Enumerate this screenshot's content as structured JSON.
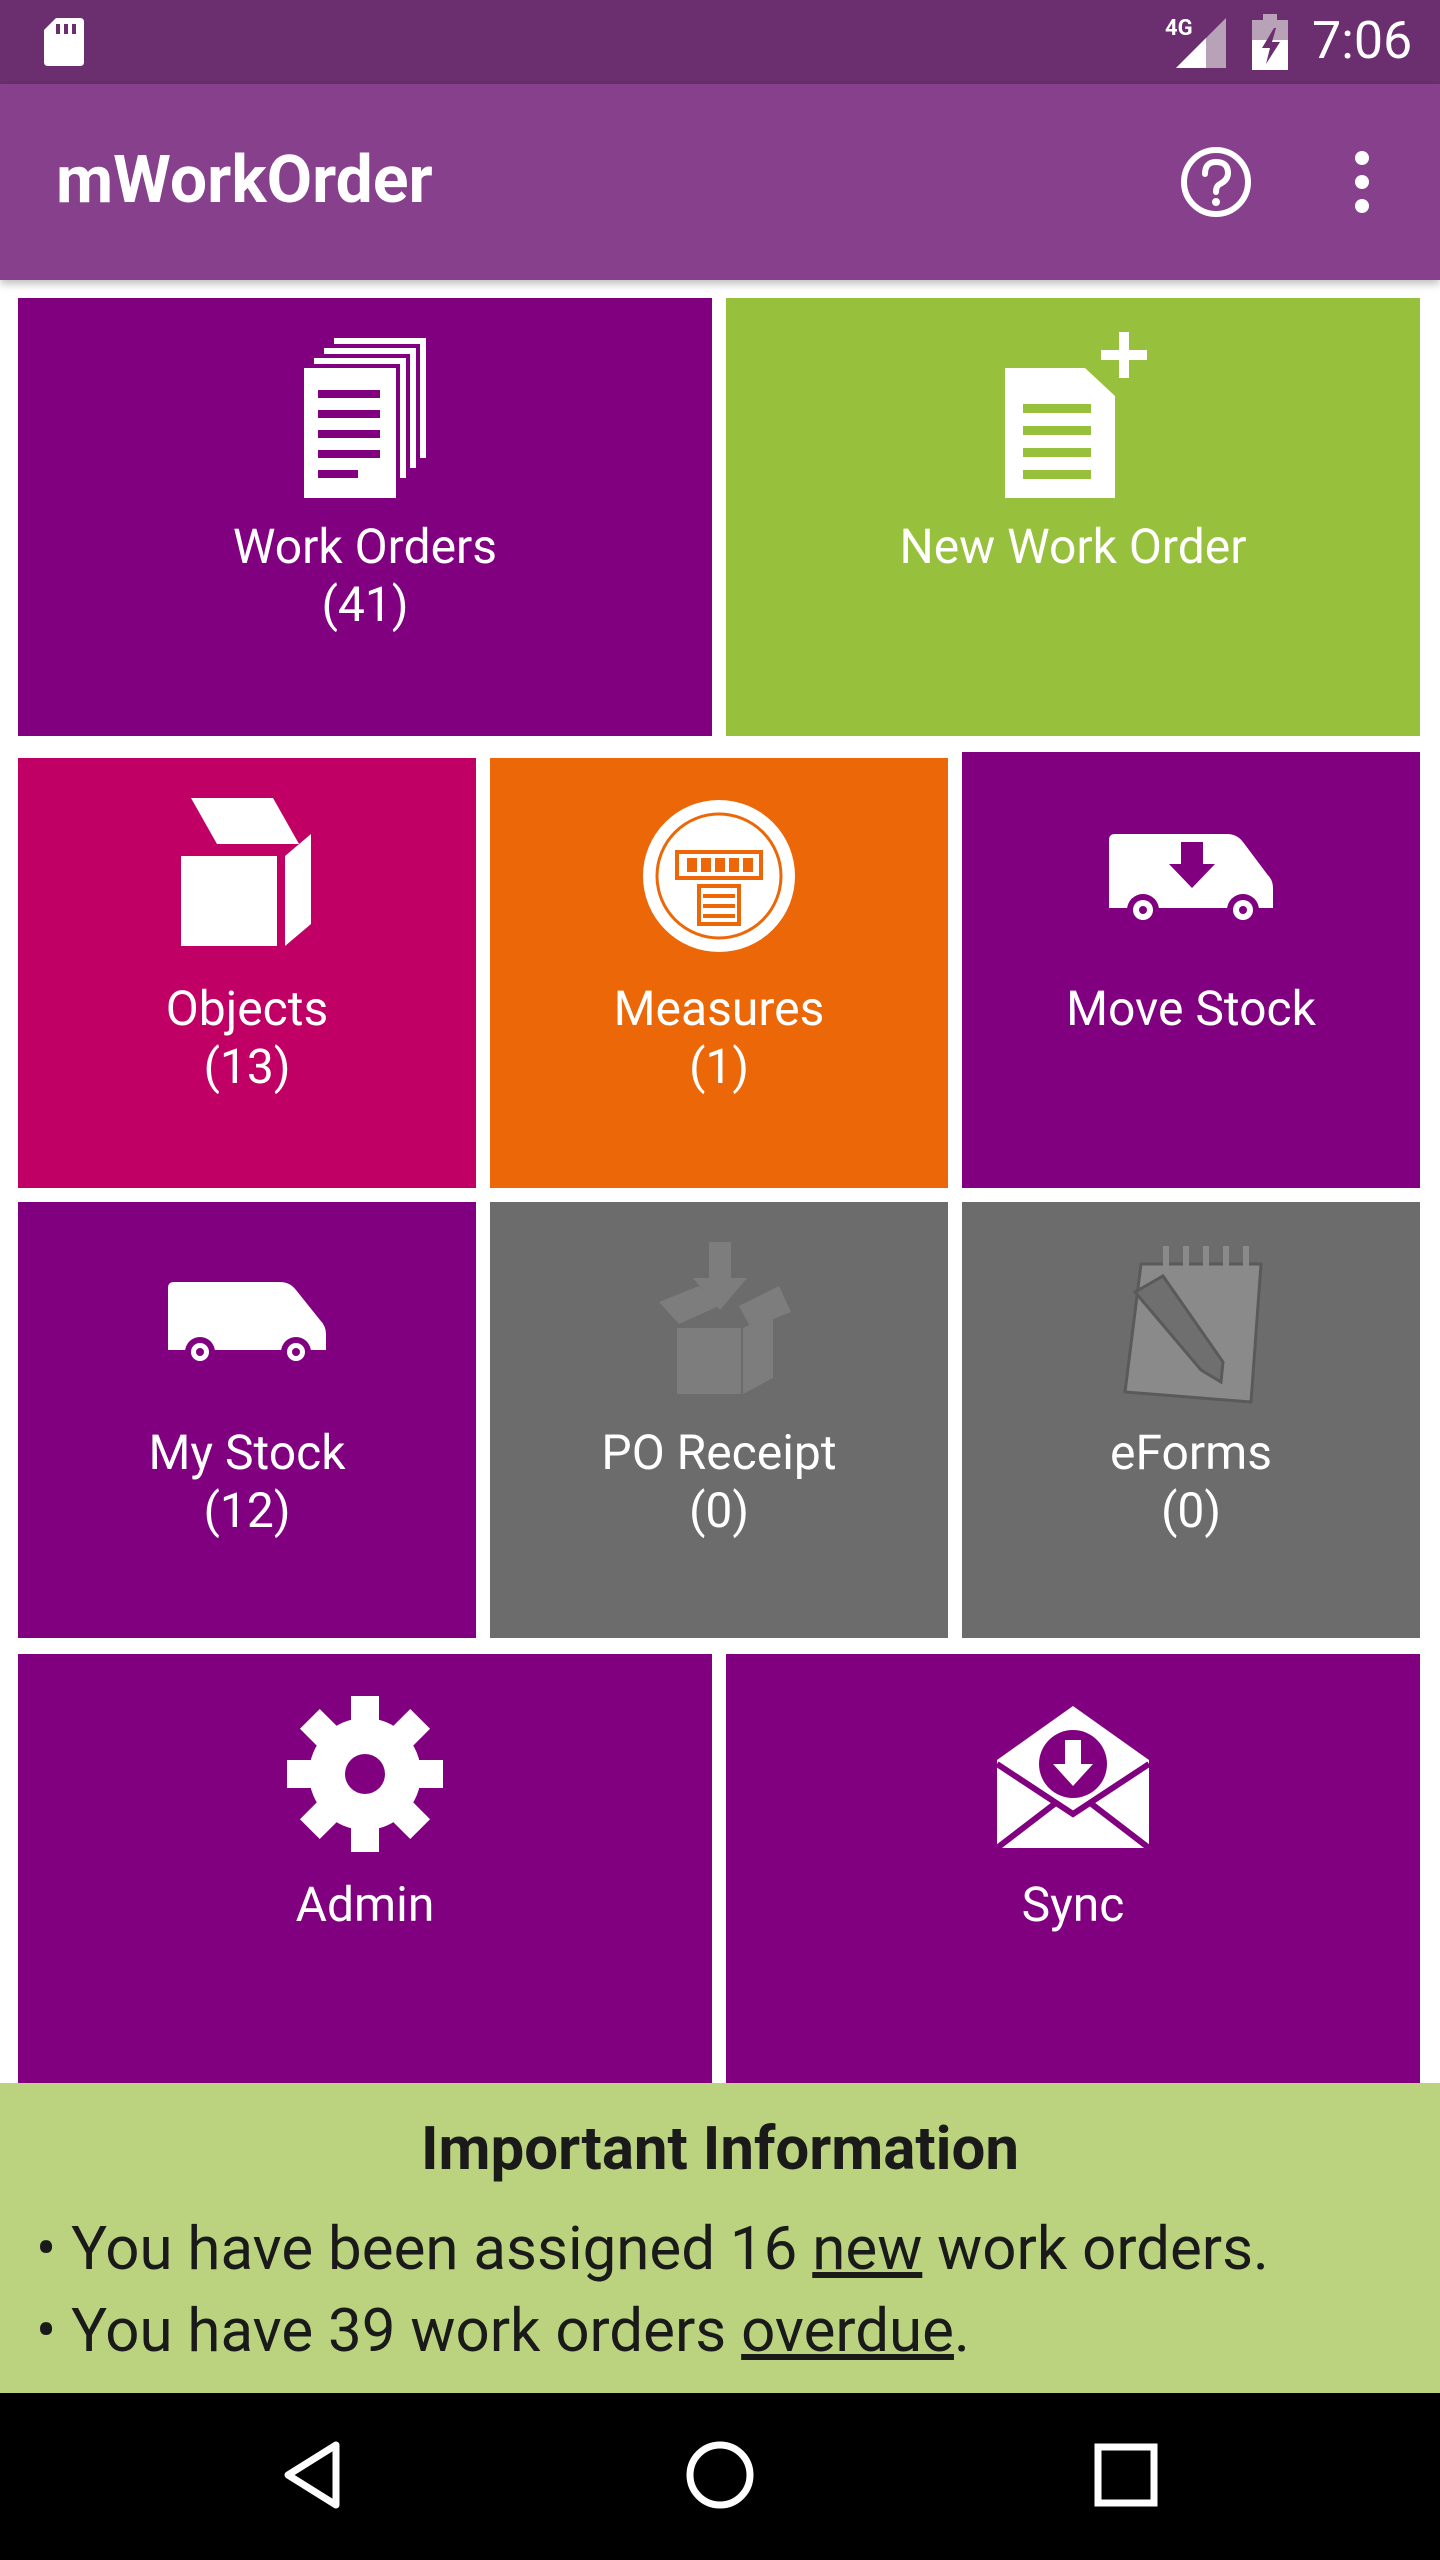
{
  "status_bar": {
    "network": "4G",
    "time": "7:06"
  },
  "app_bar": {
    "title": "mWorkOrder",
    "help_icon": "help-circle-icon",
    "menu_icon": "more-vert-icon"
  },
  "tiles": [
    {
      "id": "work-orders",
      "label": "Work Orders",
      "count": "(41)",
      "color": "#800080",
      "icon": "documents-stack-icon"
    },
    {
      "id": "new-work-order",
      "label": "New Work Order",
      "count": "",
      "color": "#97c03c",
      "icon": "document-add-icon"
    },
    {
      "id": "objects",
      "label": "Objects",
      "count": "(13)",
      "color": "#c10066",
      "icon": "box-icon"
    },
    {
      "id": "measures",
      "label": "Measures",
      "count": "(1)",
      "color": "#ec6707",
      "icon": "meter-icon"
    },
    {
      "id": "move-stock",
      "label": "Move Stock",
      "count": "",
      "color": "#800080",
      "icon": "van-download-icon"
    },
    {
      "id": "my-stock",
      "label": "My Stock",
      "count": "(12)",
      "color": "#800080",
      "icon": "van-icon"
    },
    {
      "id": "po-receipt",
      "label": "PO Receipt",
      "count": "(0)",
      "color": "#6c6c6c",
      "icon": "package-receive-icon"
    },
    {
      "id": "eforms",
      "label": "eForms",
      "count": "(0)",
      "color": "#6c6c6c",
      "icon": "notepad-pencil-icon"
    },
    {
      "id": "admin",
      "label": "Admin",
      "count": "",
      "color": "#800080",
      "icon": "gear-icon"
    },
    {
      "id": "sync",
      "label": "Sync",
      "count": "",
      "color": "#800080",
      "icon": "envelope-download-icon"
    }
  ],
  "info": {
    "title": "Important Information",
    "line1_pre": "• You have been assigned 16 ",
    "line1_link": "new",
    "line1_post": " work orders.",
    "line2_pre": "• You have 39 work orders ",
    "line2_link": "overdue",
    "line2_post": "."
  }
}
